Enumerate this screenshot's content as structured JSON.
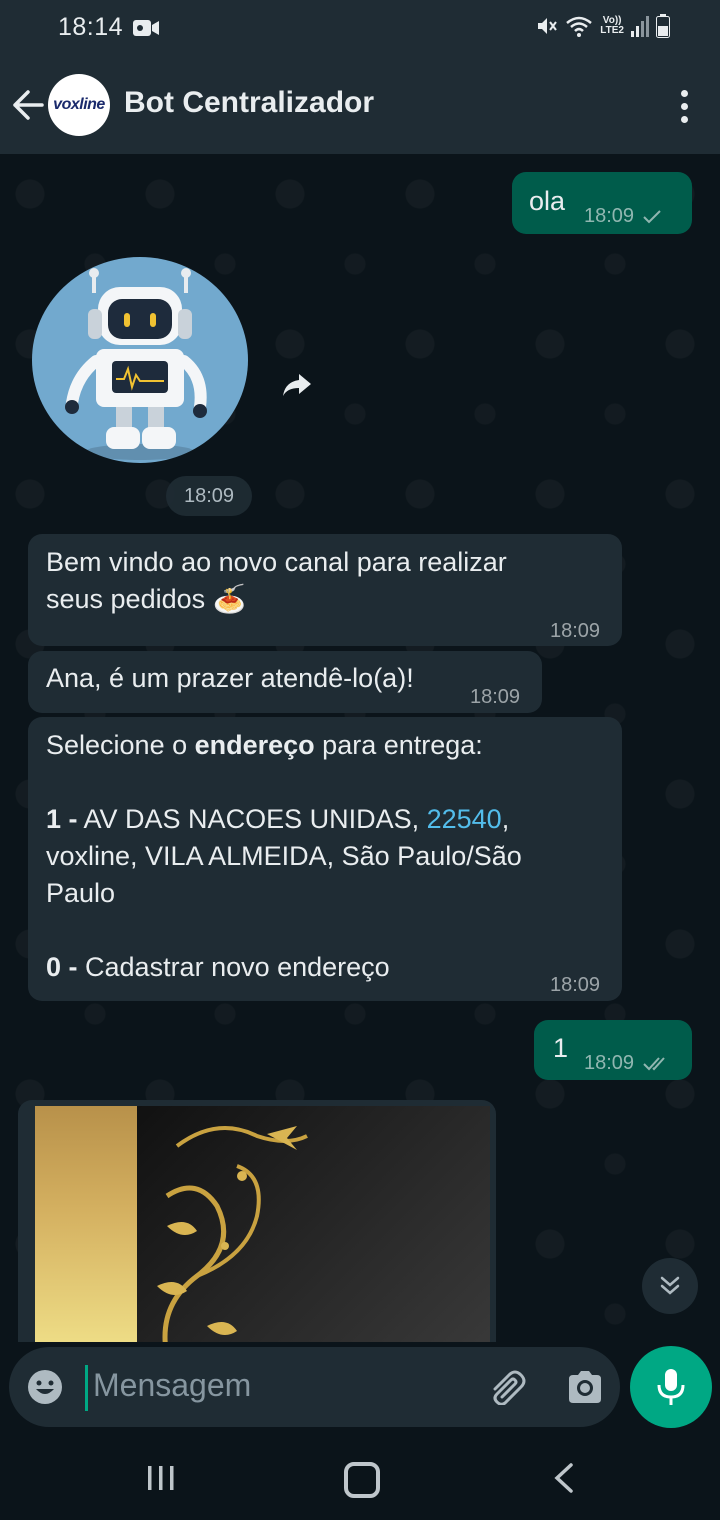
{
  "status_bar": {
    "time": "18:14",
    "network": "Vo)) LTE2",
    "network_top": "Vo))",
    "network_bottom": "LTE2"
  },
  "header": {
    "title": "Bot Centralizador",
    "avatar_text": "voxline"
  },
  "messages": {
    "m1": {
      "text": "ola",
      "time": "18:09"
    },
    "sticker": {
      "time": "18:09"
    },
    "m2": {
      "line1": "Bem vindo ao novo canal para realizar",
      "line2": "seus pedidos 🍝",
      "time": "18:09"
    },
    "m3": {
      "text": "Ana, é um prazer atendê-lo(a)!",
      "time": "18:09"
    },
    "m4": {
      "intro_before": "Selecione o ",
      "intro_bold": "endereço",
      "intro_after": " para entrega:",
      "opt1_num": "1 -",
      "opt1_text": " AV DAS NACOES UNIDAS, ",
      "opt1_link": "22540",
      "opt1_after": ",",
      "opt1_line2": "voxline, VILA ALMEIDA, São Paulo/São",
      "opt1_line3": "Paulo",
      "opt0_num": "0 -",
      "opt0_text": " Cadastrar novo endereço",
      "time": "18:09"
    },
    "m5": {
      "text": "1",
      "time": "18:09"
    }
  },
  "input": {
    "placeholder": "Mensagem"
  },
  "colors": {
    "outgoing": "#005c4b",
    "incoming": "#1f2c34",
    "accent": "#00a884",
    "link": "#53bdeb"
  },
  "icons": [
    "back-arrow-icon",
    "more-vert-icon",
    "forward-icon",
    "check-icon",
    "double-check-icon",
    "chevron-double-down-icon",
    "emoji-icon",
    "attach-icon",
    "camera-icon",
    "mic-icon",
    "nav-recent-icon",
    "nav-home-icon",
    "nav-back-icon"
  ]
}
